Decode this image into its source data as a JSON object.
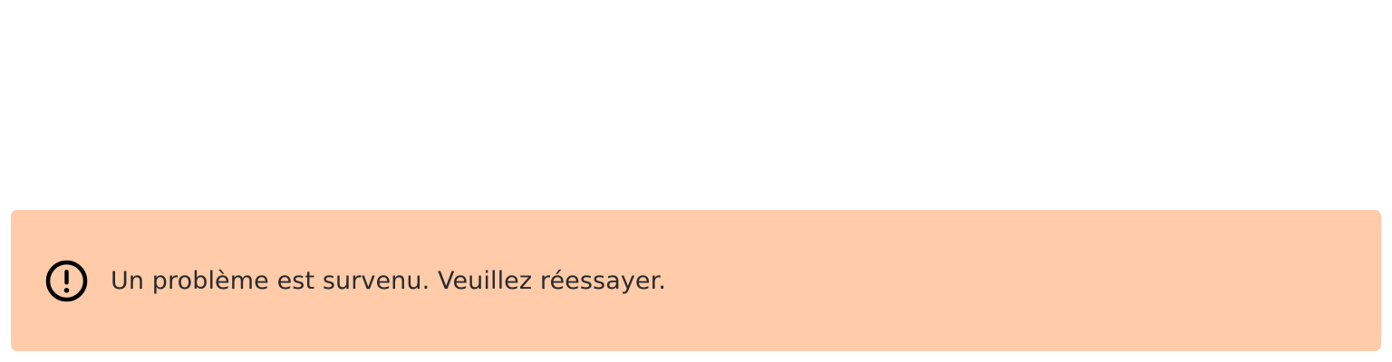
{
  "alert": {
    "icon": "exclamation-circle-icon",
    "message": "Un problème est survenu. Veuillez réessayer.",
    "background_color": "#ffcba9",
    "text_color": "#2b2b2b",
    "icon_color": "#000000"
  }
}
